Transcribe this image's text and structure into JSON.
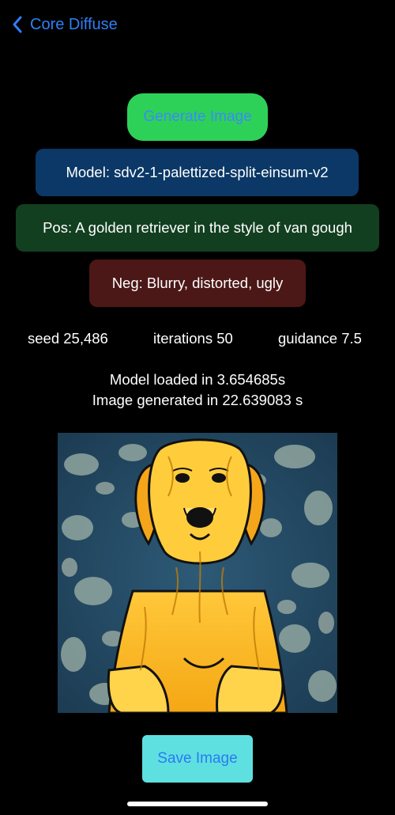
{
  "nav": {
    "back_label": "Core Diffuse"
  },
  "actions": {
    "generate_label": "Generate Image",
    "save_label": "Save Image"
  },
  "prompt": {
    "model": "Model: sdv2-1-palettized-split-einsum-v2",
    "positive": "Pos: A golden retriever in the style of van gough",
    "negative": "Neg: Blurry, distorted, ugly"
  },
  "stats": {
    "seed": "seed 25,486",
    "iterations": "iterations 50",
    "guidance": "guidance 7.5"
  },
  "timing": {
    "model_loaded": "Model loaded in 3.654685s",
    "image_generated": "Image generated in 22.639083 s"
  },
  "colors": {
    "accent_blue": "#2f7ff7",
    "generate_bg": "#2ed158",
    "model_bg": "#0b3866",
    "positive_bg": "#123f20",
    "negative_bg": "#4c1717",
    "save_bg": "#5ee0e0"
  },
  "icons": {
    "back": "chevron-left-icon"
  }
}
